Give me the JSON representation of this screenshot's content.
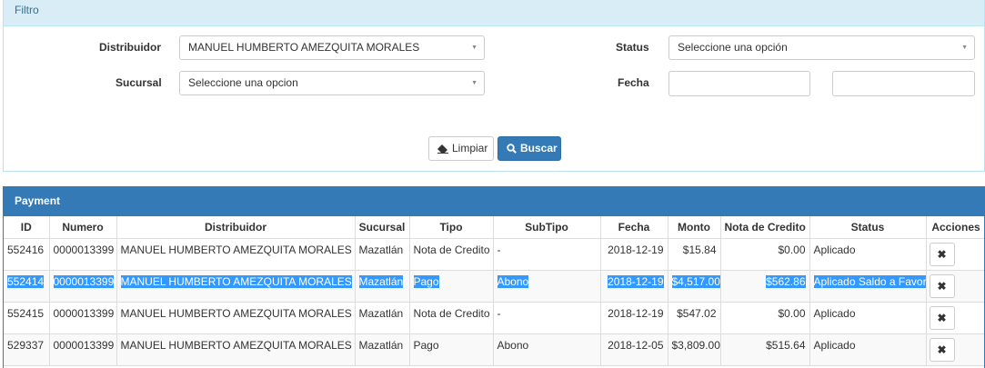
{
  "filter": {
    "heading": "Filtro",
    "distribuidor_label": "Distribuidor",
    "distribuidor_value": "MANUEL HUMBERTO AMEZQUITA MORALES",
    "sucursal_label": "Sucursal",
    "sucursal_value": "Seleccione una opcion",
    "status_label": "Status",
    "status_value": "Seleccione una opción",
    "fecha_label": "Fecha",
    "fecha_desde": "",
    "fecha_hasta": "",
    "limpiar_label": "Limpiar",
    "buscar_label": "Buscar"
  },
  "payment": {
    "heading": "Payment",
    "columns": [
      "ID",
      "Numero",
      "Distribuidor",
      "Sucursal",
      "Tipo",
      "SubTipo",
      "Fecha",
      "Monto",
      "Nota de Credito",
      "Status",
      "Acciones"
    ],
    "rows": [
      [
        "552416",
        "0000013399",
        "MANUEL HUMBERTO AMEZQUITA MORALES",
        "Mazatlán",
        "Nota de Credito",
        "-",
        "2018-12-19",
        "$15.84",
        "$0.00",
        "Aplicado"
      ],
      [
        "552414",
        "0000013399",
        "MANUEL HUMBERTO AMEZQUITA MORALES",
        "Mazatlán",
        "Pago",
        "Abono",
        "2018-12-19",
        "$4,517.00",
        "$562.86",
        "Aplicado Saldo a Favor"
      ],
      [
        "552415",
        "0000013399",
        "MANUEL HUMBERTO AMEZQUITA MORALES",
        "Mazatlán",
        "Nota de Credito",
        "-",
        "2018-12-19",
        "$547.02",
        "$0.00",
        "Aplicado"
      ],
      [
        "529337",
        "0000013399",
        "MANUEL HUMBERTO AMEZQUITA MORALES",
        "Mazatlán",
        "Pago",
        "Abono",
        "2018-12-05",
        "$3,809.00",
        "$515.64",
        "Aplicado"
      ]
    ],
    "selected_row": 1,
    "delete_icon": "times-icon"
  },
  "colors": {
    "primary": "#337ab7",
    "info_bg": "#d9edf7",
    "selection": "#3399ff"
  }
}
